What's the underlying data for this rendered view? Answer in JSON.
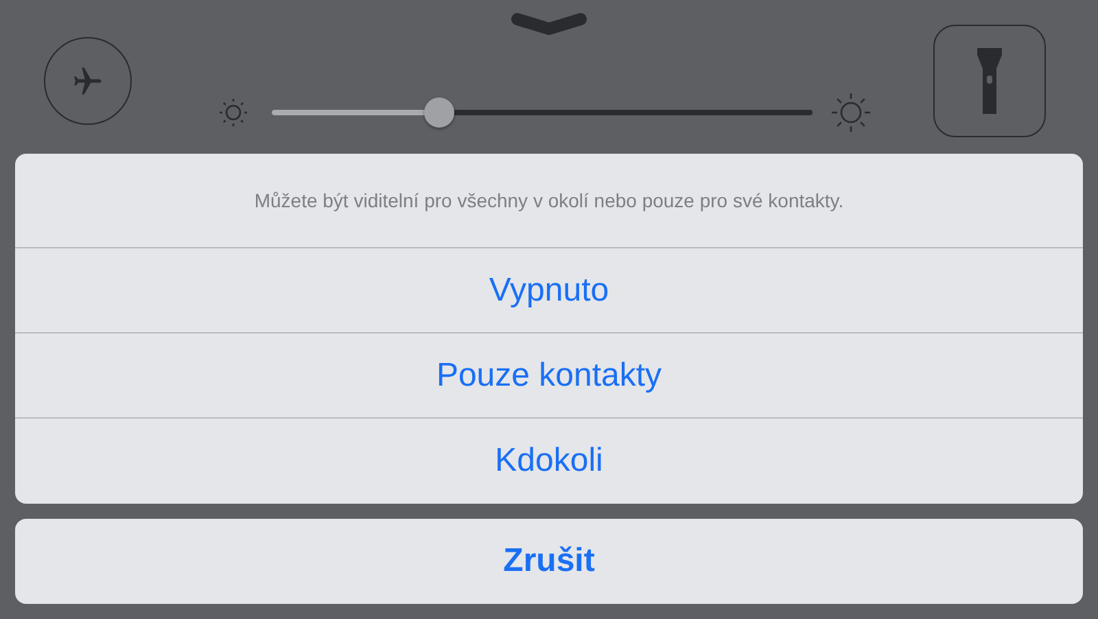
{
  "control_center": {
    "brightness": {
      "level": 0.31
    }
  },
  "action_sheet": {
    "message": "Můžete být viditelní pro všechny v okolí nebo pouze pro své kontakty.",
    "options": [
      {
        "label": "Vypnuto"
      },
      {
        "label": "Pouze kontakty"
      },
      {
        "label": "Kdokoli"
      }
    ],
    "cancel": "Zrušit"
  }
}
